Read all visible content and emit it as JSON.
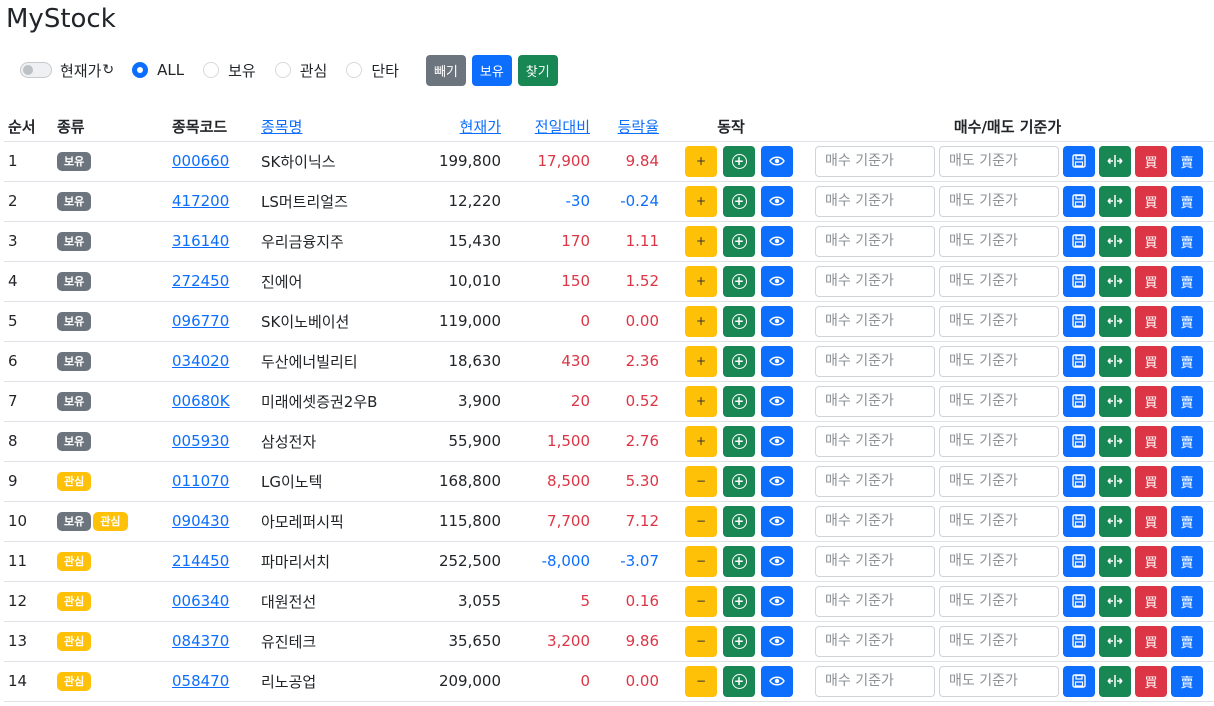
{
  "app": {
    "title": "MyStock"
  },
  "toolbar": {
    "toggle_label": "현재가",
    "refresh_glyph": "↻",
    "radios": [
      {
        "label": "ALL",
        "checked": true
      },
      {
        "label": "보유",
        "checked": false
      },
      {
        "label": "관심",
        "checked": false
      },
      {
        "label": "단타",
        "checked": false
      }
    ],
    "buttons": {
      "remove": "빼기",
      "hold": "보유",
      "find": "찾기"
    }
  },
  "table": {
    "headers": {
      "no": "순서",
      "type": "종류",
      "code": "종목코드",
      "name": "종목명",
      "price": "현재가",
      "change": "전일대비",
      "rate": "등락율",
      "action": "동작",
      "target": "매수/매도 기준가"
    },
    "placeholders": {
      "buy": "매수 기준가",
      "sell": "매도 기준가"
    },
    "button_glyphs": {
      "add": "+",
      "remove": "−",
      "buy": "買",
      "sell": "賣"
    },
    "rows": [
      {
        "no": "1",
        "badges": [
          "보유"
        ],
        "code": "000660",
        "name": "SK하이닉스",
        "price": "199,800",
        "change": "17,900",
        "rate": "9.84",
        "dir": "up",
        "watch": false
      },
      {
        "no": "2",
        "badges": [
          "보유"
        ],
        "code": "417200",
        "name": "LS머트리얼즈",
        "price": "12,220",
        "change": "-30",
        "rate": "-0.24",
        "dir": "down",
        "watch": false
      },
      {
        "no": "3",
        "badges": [
          "보유"
        ],
        "code": "316140",
        "name": "우리금융지주",
        "price": "15,430",
        "change": "170",
        "rate": "1.11",
        "dir": "up",
        "watch": false
      },
      {
        "no": "4",
        "badges": [
          "보유"
        ],
        "code": "272450",
        "name": "진에어",
        "price": "10,010",
        "change": "150",
        "rate": "1.52",
        "dir": "up",
        "watch": false
      },
      {
        "no": "5",
        "badges": [
          "보유"
        ],
        "code": "096770",
        "name": "SK이노베이션",
        "price": "119,000",
        "change": "0",
        "rate": "0.00",
        "dir": "flat",
        "watch": false
      },
      {
        "no": "6",
        "badges": [
          "보유"
        ],
        "code": "034020",
        "name": "두산에너빌리티",
        "price": "18,630",
        "change": "430",
        "rate": "2.36",
        "dir": "up",
        "watch": false
      },
      {
        "no": "7",
        "badges": [
          "보유"
        ],
        "code": "00680K",
        "name": "미래에셋증권2우B",
        "price": "3,900",
        "change": "20",
        "rate": "0.52",
        "dir": "up",
        "watch": false
      },
      {
        "no": "8",
        "badges": [
          "보유"
        ],
        "code": "005930",
        "name": "삼성전자",
        "price": "55,900",
        "change": "1,500",
        "rate": "2.76",
        "dir": "up",
        "watch": false
      },
      {
        "no": "9",
        "badges": [
          "관심"
        ],
        "code": "011070",
        "name": "LG이노텍",
        "price": "168,800",
        "change": "8,500",
        "rate": "5.30",
        "dir": "up",
        "watch": true
      },
      {
        "no": "10",
        "badges": [
          "보유",
          "관심"
        ],
        "code": "090430",
        "name": "아모레퍼시픽",
        "price": "115,800",
        "change": "7,700",
        "rate": "7.12",
        "dir": "up",
        "watch": true
      },
      {
        "no": "11",
        "badges": [
          "관심"
        ],
        "code": "214450",
        "name": "파마리서치",
        "price": "252,500",
        "change": "-8,000",
        "rate": "-3.07",
        "dir": "down",
        "watch": true
      },
      {
        "no": "12",
        "badges": [
          "관심"
        ],
        "code": "006340",
        "name": "대원전선",
        "price": "3,055",
        "change": "5",
        "rate": "0.16",
        "dir": "up",
        "watch": true
      },
      {
        "no": "13",
        "badges": [
          "관심"
        ],
        "code": "084370",
        "name": "유진테크",
        "price": "35,650",
        "change": "3,200",
        "rate": "9.86",
        "dir": "up",
        "watch": true
      },
      {
        "no": "14",
        "badges": [
          "관심"
        ],
        "code": "058470",
        "name": "리노공업",
        "price": "209,000",
        "change": "0",
        "rate": "0.00",
        "dir": "flat",
        "watch": true
      }
    ]
  },
  "colors": {
    "primary": "#0d6efd",
    "success": "#198754",
    "danger": "#dc3545",
    "warning": "#ffc107",
    "secondary": "#6c757d"
  }
}
